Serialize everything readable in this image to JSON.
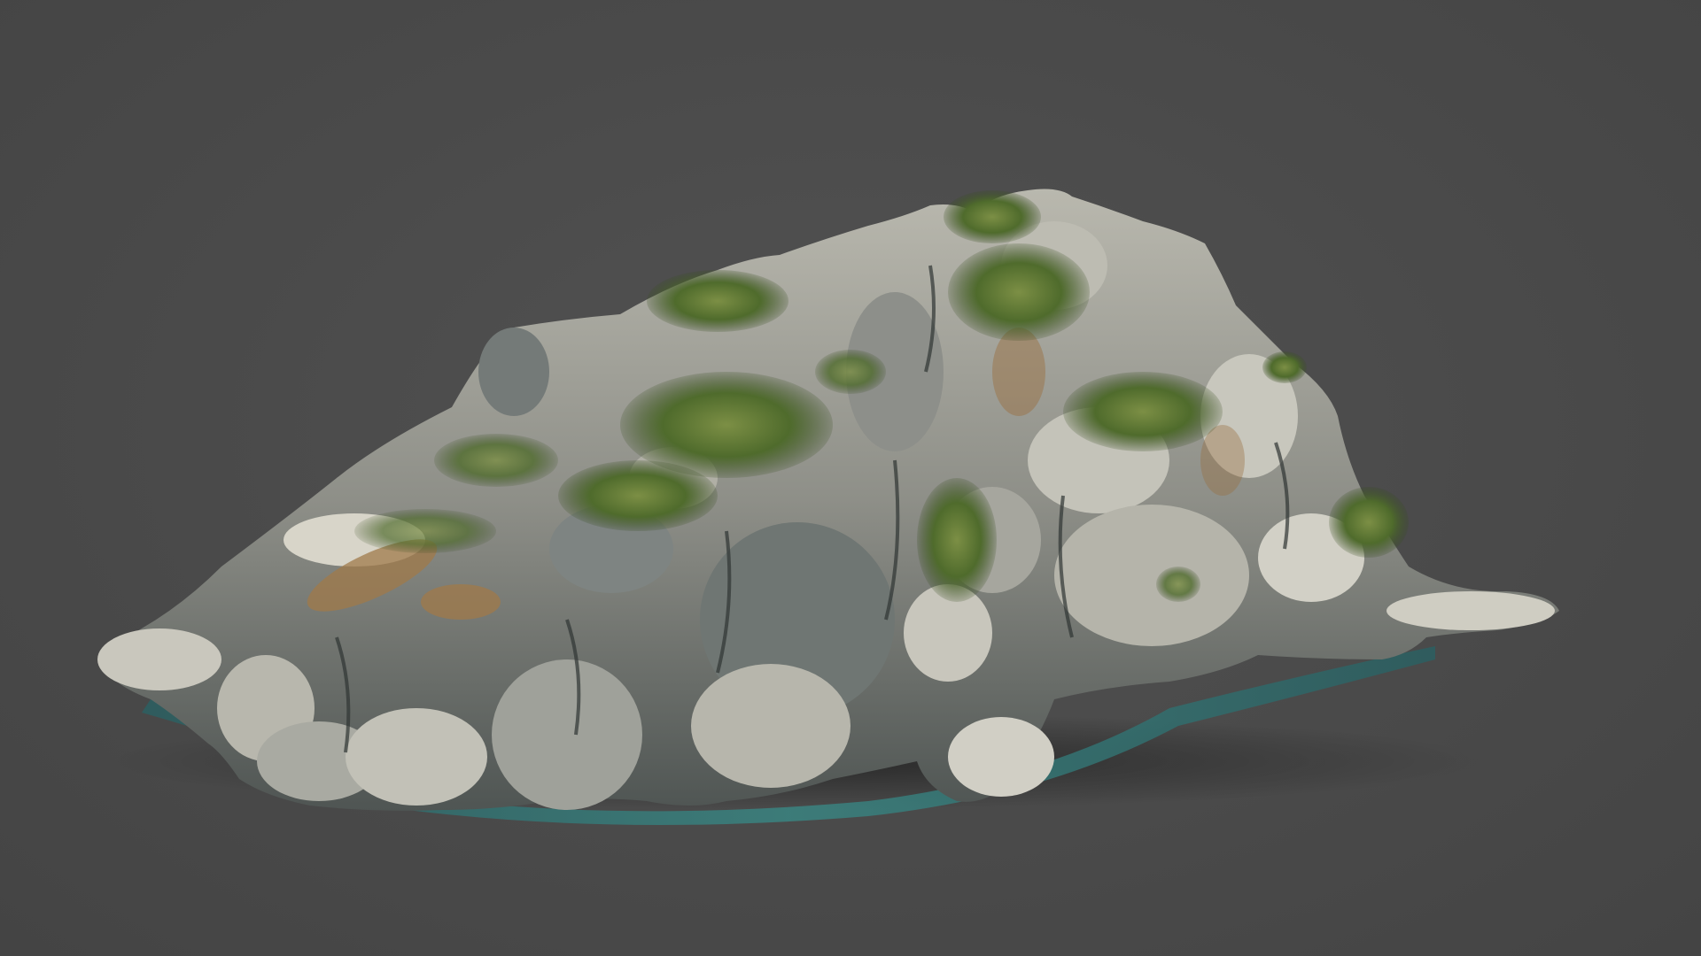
{
  "viewer": {
    "background_color": "#4a4a4a"
  },
  "model": {
    "subject": "rocky-islet-photogrammetry-model",
    "colors": {
      "rock_light": "#c9c7bd",
      "rock_mid": "#8e8f88",
      "rock_dark": "#4f5553",
      "moss": "#4f6b2c",
      "moss_light": "#7c8f45",
      "soil": "#a07a4a",
      "water": "#2e6f70"
    }
  }
}
